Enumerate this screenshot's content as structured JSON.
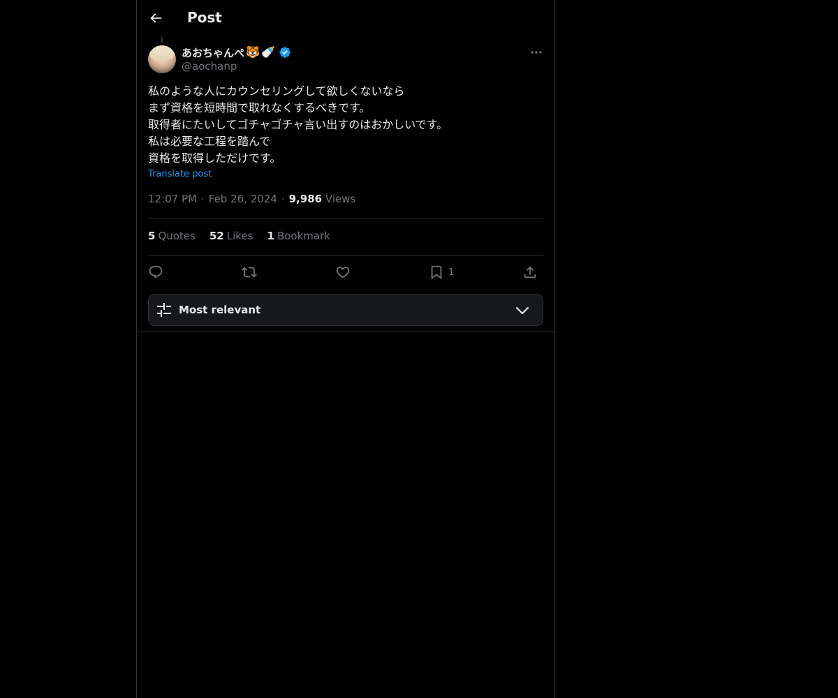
{
  "header": {
    "title": "Post"
  },
  "post": {
    "author": {
      "display_name": "あおちゃんぺ",
      "emojis": [
        "🐯",
        "🍼"
      ],
      "handle": "@aochanp",
      "verified": true
    },
    "text_lines": [
      "私のような人にカウンセリングして欲しくないなら",
      "まず資格を短時間で取れなくするべきです。",
      "取得者にたいしてゴチャゴチャ言い出すのはおかしいです。",
      "私は必要な工程を踏んで",
      "資格を取得しただけです。"
    ],
    "translate_label": "Translate post",
    "time": "12:07 PM",
    "date": "Feb 26, 2024",
    "views_count": "9,986",
    "views_label": "Views"
  },
  "stats": {
    "quotes_count": "5",
    "quotes_label": "Quotes",
    "likes_count": "52",
    "likes_label": "Likes",
    "bookmarks_count": "1",
    "bookmarks_label": "Bookmark"
  },
  "actions": {
    "bookmark_count": "1",
    "icons": [
      "reply-icon",
      "repost-icon",
      "like-icon",
      "bookmark-icon",
      "share-icon"
    ]
  },
  "sort": {
    "label": "Most relevant"
  },
  "colors": {
    "background": "#000000",
    "text": "#e7e9ea",
    "muted": "#71767b",
    "accent": "#1d9bf0",
    "border": "#2f3336"
  }
}
